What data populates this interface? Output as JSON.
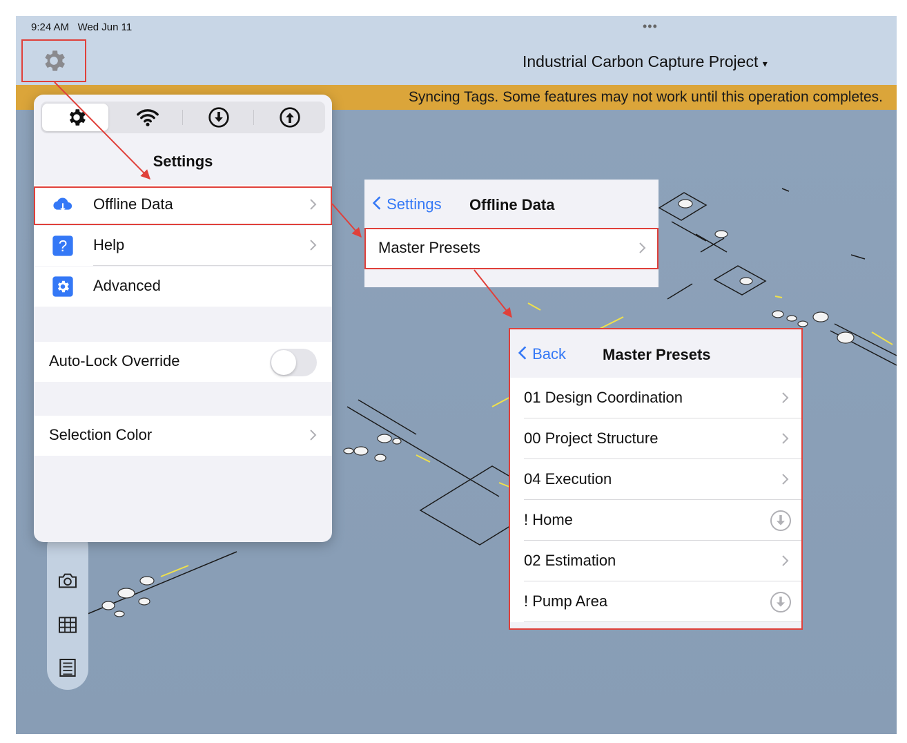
{
  "status": {
    "time": "9:24 AM",
    "date": "Wed Jun 11",
    "dots": "•••"
  },
  "project": {
    "title": "Industrial Carbon Capture Project",
    "caret": "▾"
  },
  "banner": {
    "text": "Syncing Tags. Some features may not work until this operation completes."
  },
  "settings": {
    "title": "Settings",
    "tabs": [
      "settings-gear",
      "wifi",
      "download",
      "upload"
    ],
    "menu": [
      {
        "label": "Offline Data",
        "icon": "cloud-download-icon"
      },
      {
        "label": "Help",
        "icon": "question-icon"
      },
      {
        "label": "Advanced",
        "icon": "gear-icon"
      }
    ],
    "auto_lock": {
      "label": "Auto-Lock Override",
      "on": false
    },
    "selection_color": {
      "label": "Selection Color"
    }
  },
  "offline": {
    "back_label": "Settings",
    "title": "Offline Data",
    "items": [
      {
        "label": "Master Presets"
      }
    ]
  },
  "presets": {
    "back_label": "Back",
    "title": "Master Presets",
    "items": [
      {
        "label": "01 Design Coordination",
        "action": "chevron"
      },
      {
        "label": "00 Project Structure",
        "action": "chevron"
      },
      {
        "label": "04 Execution",
        "action": "chevron"
      },
      {
        "label": "! Home",
        "action": "download"
      },
      {
        "label": "02 Estimation",
        "action": "chevron"
      },
      {
        "label": "! Pump Area",
        "action": "download"
      }
    ]
  },
  "toolbar": {
    "tools": [
      "camera-icon",
      "grid-icon",
      "floorplan-icon"
    ]
  },
  "colors": {
    "accent": "#3478f6",
    "banner": "#dba53a",
    "highlight": "#e0403a",
    "scene": "#8ea3bb"
  }
}
